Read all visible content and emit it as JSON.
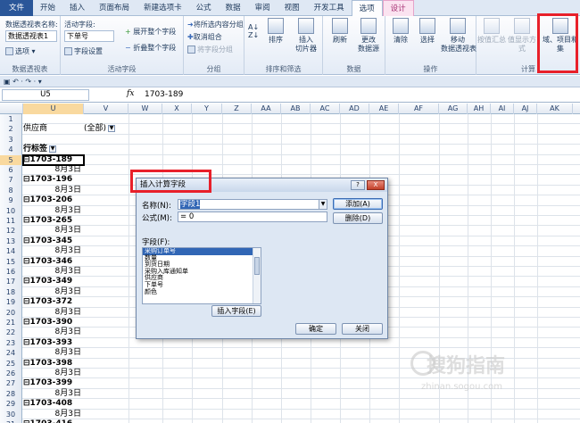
{
  "ribbon_tabs": [
    "文件",
    "开始",
    "插入",
    "页面布局",
    "新建选项卡",
    "公式",
    "数据",
    "审阅",
    "视图",
    "开发工具",
    "选项",
    "设计"
  ],
  "ribbon": {
    "pivot_group": {
      "name_label": "数据透视表名称:",
      "name_value": "数据透视表1",
      "options_label": "选项",
      "group_label": "数据透视表"
    },
    "active_field_group": {
      "label": "活动字段:",
      "value": "下单号",
      "field_settings": "字段设置",
      "expand_all": "展开整个字段",
      "collapse_all": "折叠整个字段",
      "group_label": "活动字段"
    },
    "group_group": {
      "group_selection": "将所选内容分组",
      "ungroup": "取消组合",
      "group_field": "将字段分组",
      "group_label": "分组"
    },
    "sort_group": {
      "sort": "排序",
      "slicer": "插入\n切片器",
      "group_label": "排序和筛选"
    },
    "data_group": {
      "refresh": "刷新",
      "change_source": "更改\n数据源",
      "group_label": "数据"
    },
    "actions_group": {
      "clear": "清除",
      "select": "选择",
      "move": "移动\n数据透视表",
      "group_label": "操作"
    },
    "calc_group": {
      "summarize": "按值汇总",
      "show_values": "值显示方式",
      "fields_items": "域、项目和\n集",
      "group_label": "计算"
    }
  },
  "qat": "▣ ↶ · ↷ · ▾",
  "formula_bar": {
    "name_box": "U5",
    "fx": "fx",
    "formula": "1703-189"
  },
  "columns": [
    "U",
    "V",
    "W",
    "X",
    "Y",
    "Z",
    "AA",
    "AB",
    "AC",
    "AD",
    "AE",
    "AF",
    "AG",
    "AH",
    "AI",
    "AJ",
    "AK"
  ],
  "rows": [
    {
      "n": "1",
      "u": "",
      "v": ""
    },
    {
      "n": "2",
      "u": "供应商",
      "v": "(全部)",
      "filter": true
    },
    {
      "n": "3",
      "u": "",
      "v": ""
    },
    {
      "n": "4",
      "u": "行标签",
      "v": "",
      "header": true
    },
    {
      "n": "5",
      "u": "⊟1703-189",
      "v": "",
      "group": true,
      "selected": true
    },
    {
      "n": "6",
      "u": "8月3日",
      "v": "",
      "date": true
    },
    {
      "n": "7",
      "u": "⊟1703-196",
      "v": "",
      "group": true
    },
    {
      "n": "8",
      "u": "8月3日",
      "v": "",
      "date": true
    },
    {
      "n": "9",
      "u": "⊟1703-206",
      "v": "",
      "group": true
    },
    {
      "n": "10",
      "u": "8月3日",
      "v": "",
      "date": true
    },
    {
      "n": "11",
      "u": "⊟1703-265",
      "v": "",
      "group": true
    },
    {
      "n": "12",
      "u": "8月3日",
      "v": "",
      "date": true
    },
    {
      "n": "13",
      "u": "⊟1703-345",
      "v": "",
      "group": true
    },
    {
      "n": "14",
      "u": "8月3日",
      "v": "",
      "date": true
    },
    {
      "n": "15",
      "u": "⊟1703-346",
      "v": "",
      "group": true
    },
    {
      "n": "16",
      "u": "8月3日",
      "v": "",
      "date": true
    },
    {
      "n": "17",
      "u": "⊟1703-349",
      "v": "",
      "group": true
    },
    {
      "n": "18",
      "u": "8月3日",
      "v": "",
      "date": true
    },
    {
      "n": "19",
      "u": "⊟1703-372",
      "v": "",
      "group": true
    },
    {
      "n": "20",
      "u": "8月3日",
      "v": "",
      "date": true
    },
    {
      "n": "21",
      "u": "⊟1703-390",
      "v": "",
      "group": true
    },
    {
      "n": "22",
      "u": "8月3日",
      "v": "",
      "date": true
    },
    {
      "n": "23",
      "u": "⊟1703-393",
      "v": "",
      "group": true
    },
    {
      "n": "24",
      "u": "8月3日",
      "v": "",
      "date": true
    },
    {
      "n": "25",
      "u": "⊟1703-398",
      "v": "",
      "group": true
    },
    {
      "n": "26",
      "u": "8月3日",
      "v": "",
      "date": true
    },
    {
      "n": "27",
      "u": "⊟1703-399",
      "v": "",
      "group": true
    },
    {
      "n": "28",
      "u": "8月3日",
      "v": "",
      "date": true
    },
    {
      "n": "29",
      "u": "⊟1703-408",
      "v": "",
      "group": true
    },
    {
      "n": "30",
      "u": "8月3日",
      "v": "",
      "date": true
    },
    {
      "n": "31",
      "u": "⊟1703-416",
      "v": "",
      "group": true
    }
  ],
  "dialog": {
    "title": "插入计算字段",
    "help": "?",
    "close": "X",
    "name_label": "名称(N):",
    "name_value": "字段1",
    "formula_label": "公式(M):",
    "formula_value": "= 0",
    "add_button": "添加(A)",
    "delete_button": "删除(D)",
    "fields_label": "字段(F):",
    "fields": [
      "采购订单号",
      "数量",
      "到货日期",
      "采购入库通知单",
      "供应商",
      "下单号",
      "颜色"
    ],
    "insert_field_button": "插入字段(E)",
    "ok_button": "确定",
    "close_button": "关闭"
  },
  "watermark": {
    "text": "搜狗指南",
    "sub": "zhinan.sogou.com"
  },
  "colors": {
    "highlight": "#e8202a",
    "file_tab": "#2a5699",
    "selection": "#3166b5"
  }
}
